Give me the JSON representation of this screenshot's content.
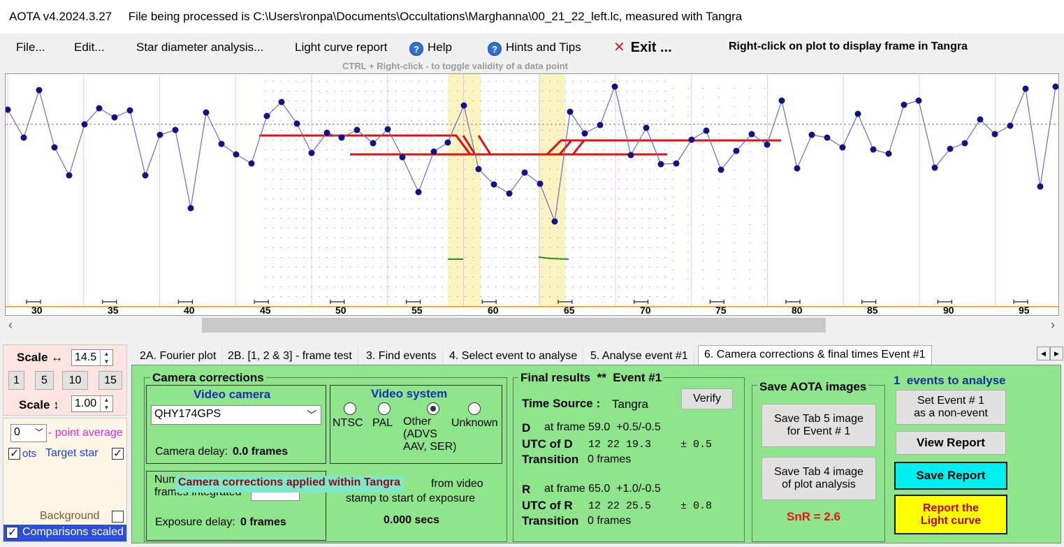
{
  "title": "AOTA v4.2024.3.27     File being processed is C:\\Users\\ronpa\\Documents\\Occultations\\Marghanna\\00_21_22_left.lc, measured with Tangra",
  "menu": {
    "file": "File...",
    "edit": "Edit...",
    "star_diameter": "Star diameter analysis...",
    "light_curve_report": "Light curve report",
    "help": "Help",
    "hints": "Hints and Tips",
    "exit": "Exit ...",
    "help_glyph": "?",
    "exit_glyph": "✕"
  },
  "right_click_hint": "Right-click on plot to display frame in Tangra",
  "ctrl_hint": "CTRL + Right-click  -  to toggle validity of a data point",
  "plot": {
    "x_ticks": [
      "30",
      "35",
      "40",
      "45",
      "50",
      "55",
      "60",
      "65",
      "70",
      "75",
      "80",
      "85",
      "90",
      "95"
    ]
  },
  "scale_panel": {
    "scale_h_label": "Scale ↔",
    "scale_h_value": "14.5",
    "buttons": [
      "1",
      "5",
      "10",
      "15"
    ],
    "scale_v_label": "Scale ↕",
    "scale_v_value": "1.00"
  },
  "legend_panel": {
    "point_avg_value": "0",
    "point_avg_label": "- point average",
    "dots_label": "ots",
    "target_star": "Target star",
    "background": "Background",
    "comparisons": "Comparisons scaled"
  },
  "tabs": [
    "2A. Fourier plot",
    "2B. [1, 2 & 3] - frame test",
    "3. Find events",
    "4. Select event to analyse",
    "5. Analyse event #1",
    "6. Camera corrections & final times Event #1"
  ],
  "camera": {
    "group_title": "Camera corrections",
    "video_camera_title": "Video camera",
    "camera_value": "QHY174GPS",
    "camera_delay_label": "Camera delay:",
    "camera_delay_value": "0.0 frames",
    "video_system_title": "Video system",
    "systems": [
      "NTSC",
      "PAL",
      "Other\n(ADVS\nAAV, SER)",
      "Unknown"
    ],
    "num_frames_label": "Num\nframes integrated",
    "overlay_note": "Camera corrections applied within Tangra",
    "from_video": "from video",
    "stamp_to_start": "stamp to start of exposure",
    "exposure_delay_label": "Exposure delay:",
    "exposure_delay_value": "0 frames",
    "secs_value": "0.000 secs"
  },
  "final": {
    "title": "Final results  **  Event #1",
    "time_source_label": "Time Source :",
    "time_source_value": "Tangra",
    "verify": "Verify",
    "d_letter": "D",
    "d_frame": "at frame 59.0  +0.5/-0.5",
    "utc_d_label": "UTC of D",
    "utc_d_value": "12 22 19.3",
    "utc_d_err": "± 0.5",
    "transition_label": "Transition",
    "transition_d": "0 frames",
    "r_letter": "R",
    "r_frame": "at frame 65.0  +1.0/-0.5",
    "utc_r_label": "UTC of R",
    "utc_r_value": "12 22 25.5",
    "utc_r_err": "± 0.8",
    "transition_r": "0 frames"
  },
  "save_images": {
    "title": "Save AOTA images",
    "tab5": "Save Tab 5 image\nfor Event # 1",
    "tab4": "Save Tab 4 image\nof plot analysis",
    "snr": "SnR = 2.6"
  },
  "right_actions": {
    "events_count": "1  events to analyse",
    "non_event": "Set Event # 1\nas a non-event",
    "view_report": "View Report",
    "save_report": "Save Report",
    "report_lc": "Report the\nLight curve"
  }
}
